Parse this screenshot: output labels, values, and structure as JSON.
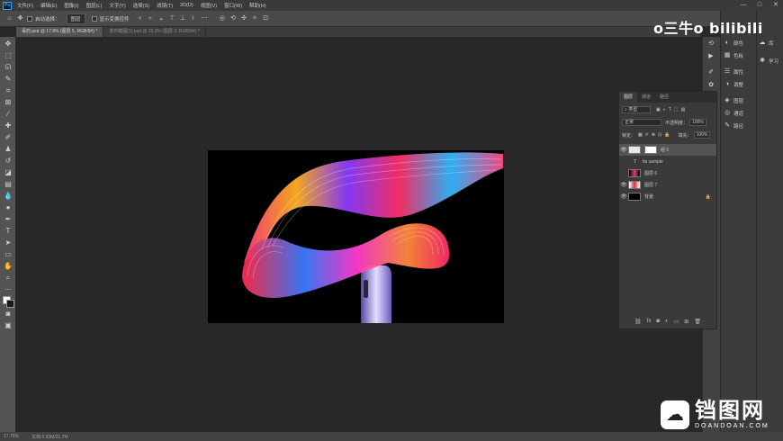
{
  "app": {
    "logo": "Ps"
  },
  "menu": [
    "文件(F)",
    "编辑(E)",
    "图像(I)",
    "图层(L)",
    "文字(Y)",
    "选择(S)",
    "滤镜(T)",
    "3D(D)",
    "视图(V)",
    "窗口(W)",
    "帮助(H)"
  ],
  "window_controls": {
    "minimize": "—",
    "maximize": "□",
    "close": "✕"
  },
  "options": {
    "auto_select_label": "自动选择：",
    "auto_select_value": "图层",
    "show_transform_label": "显示变换控件"
  },
  "doc_tabs": [
    {
      "label": "毒药.psd @ 17.8% (图层 5, RGB/8#) *",
      "active": true
    },
    {
      "label": "发布截图(1).psd @ 33.3% (图层 2, RGB/8#) *",
      "active": false
    }
  ],
  "status": {
    "zoom": "17.76%",
    "doc": "文档:5.93M/21.7M"
  },
  "dock": {
    "strip2": [
      "颜色",
      "色板",
      "属性",
      "调整",
      "图层",
      "通道",
      "路径"
    ],
    "strip3": [
      "库",
      "学习"
    ]
  },
  "layers_panel": {
    "tabs": [
      "图层",
      "通道",
      "路径"
    ],
    "kind_label": "类型",
    "blend_mode": "正常",
    "opacity_label": "不透明度：",
    "opacity_value": "100%",
    "lock_label": "锁定：",
    "fill_label": "填充：",
    "fill_value": "100%",
    "layers": [
      {
        "name": "组 5",
        "selected": true,
        "visible": true
      },
      {
        "name": "Its sample",
        "selected": false,
        "visible": false
      },
      {
        "name": "图层 6",
        "selected": false,
        "visible": false
      },
      {
        "name": "图层 7",
        "selected": false,
        "visible": true
      },
      {
        "name": "背景",
        "selected": false,
        "visible": true
      }
    ]
  },
  "watermarks": {
    "bilibili": "o三牛o bilibili",
    "site_cn": "铛图网",
    "site_en": "DOANDOAN.COM"
  }
}
